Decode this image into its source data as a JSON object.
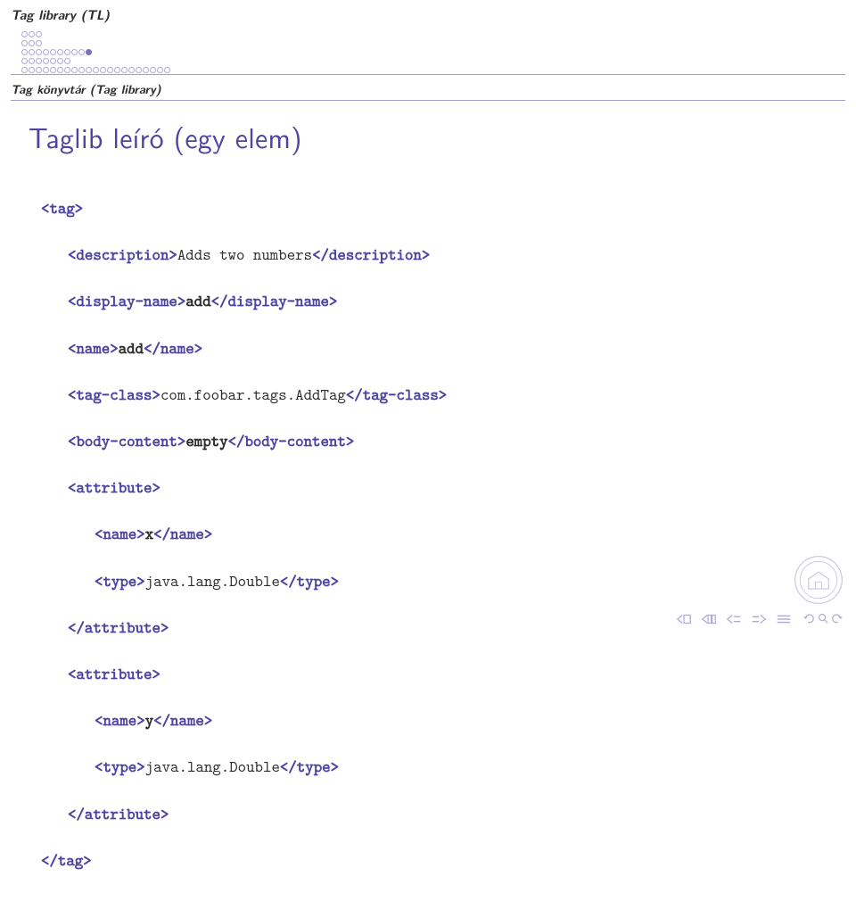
{
  "header": {
    "section_title": "Tag library (TL)",
    "breadcrumb": "Tag könyvtár (Tag library)"
  },
  "slide": {
    "title": "Taglib leíró (egy elem)"
  },
  "code": {
    "tag_open": "<tag>",
    "desc_open": "<description>",
    "desc_text": "Adds two numbers",
    "desc_close": "</description>",
    "dispname_open": "<display-name>",
    "dispname_text": "add",
    "dispname_close": "</display-name>",
    "name_open": "<name>",
    "name_text1": "add",
    "name_close": "</name>",
    "tagclass_open": "<tag-class>",
    "tagclass_text": "com.foobar.tags.AddTag",
    "tagclass_close": "</tag-class>",
    "bodycontent_open": "<body-content>",
    "bodycontent_text": "empty",
    "bodycontent_close": "</body-content>",
    "attribute_open": "<attribute>",
    "attr1_name": "x",
    "type_open": "<type>",
    "type_text": "java.lang.Double",
    "type_close": "</type>",
    "attribute_close": "</attribute>",
    "attr2_name": "y",
    "tag_close": "</tag>"
  }
}
